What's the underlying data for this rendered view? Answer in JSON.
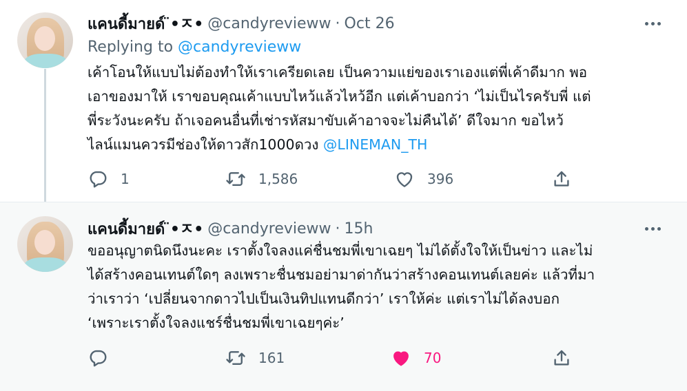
{
  "tweets": [
    {
      "display_name": "แคนดี้มายด์ ̈•ㅈ•",
      "handle": "@candyrevieww",
      "separator": "·",
      "time": "Oct 26",
      "replying_prefix": "Replying to",
      "replying_handle": "@candyrevieww",
      "text": "เค้าโอนให้แบบไม่ต้องทำให้เราเครียดเลย เป็นความแย่ของเราเองแต่พี่เค้าดีมาก พอ\nเอาของมาให้ เราขอบคุณเค้าแบบไหว้แล้วไหว้อีก แต่เค้าบอกว่า ‘ไม่เป็นไรครับพี่ แต่\nพี่ระวังนะครับ ถ้าเจอคนอื่นที่เช่ารหัสมาขับเค้าอาจจะไม่คืนได้’ ดีใจมาก ขอไหว้\nไลน์แมนควรมีช่องให้ดาวสัก1000ดวง ",
      "mention": "@LINEMAN_TH",
      "reply_count": "1",
      "retweet_count": "1,586",
      "like_count": "396",
      "liked": false
    },
    {
      "display_name": "แคนดี้มายด์ ̈•ㅈ•",
      "handle": "@candyrevieww",
      "separator": "·",
      "time": "15h",
      "text": "ขออนุญาตนิดนึงนะคะ เราตั้งใจลงแค่ชื่นชมพี่เขาเฉยๆ ไม่ได้ตั้งใจให้เป็นข่าว และไม่\nได้สร้างคอนเทนต์ใดๆ ลงเพราะชื่นชมอย่ามาด่ากันว่าสร้างคอนเทนต์เลยค่ะ แล้วที่มา\nว่าเราว่า ‘เปลี่ยนจากดาวไปเป็นเงินทิปแทนดีกว่า’ เราให้ค่ะ แต่เราไม่ได้ลงบอก\n‘เพราะเราตั้งใจลงแชร์ชื่นชมพี่เขาเฉยๆค่ะ’",
      "reply_count": "",
      "retweet_count": "161",
      "like_count": "70",
      "liked": true
    }
  ],
  "colors": {
    "text": "#0f1419",
    "secondary": "#536471",
    "link": "#1d9bf0",
    "like": "#f91880",
    "thread_line": "#cfd9de",
    "hover_bg": "#f7f9f9"
  },
  "icons": [
    "more-icon",
    "reply-icon",
    "retweet-icon",
    "like-icon",
    "share-icon"
  ]
}
